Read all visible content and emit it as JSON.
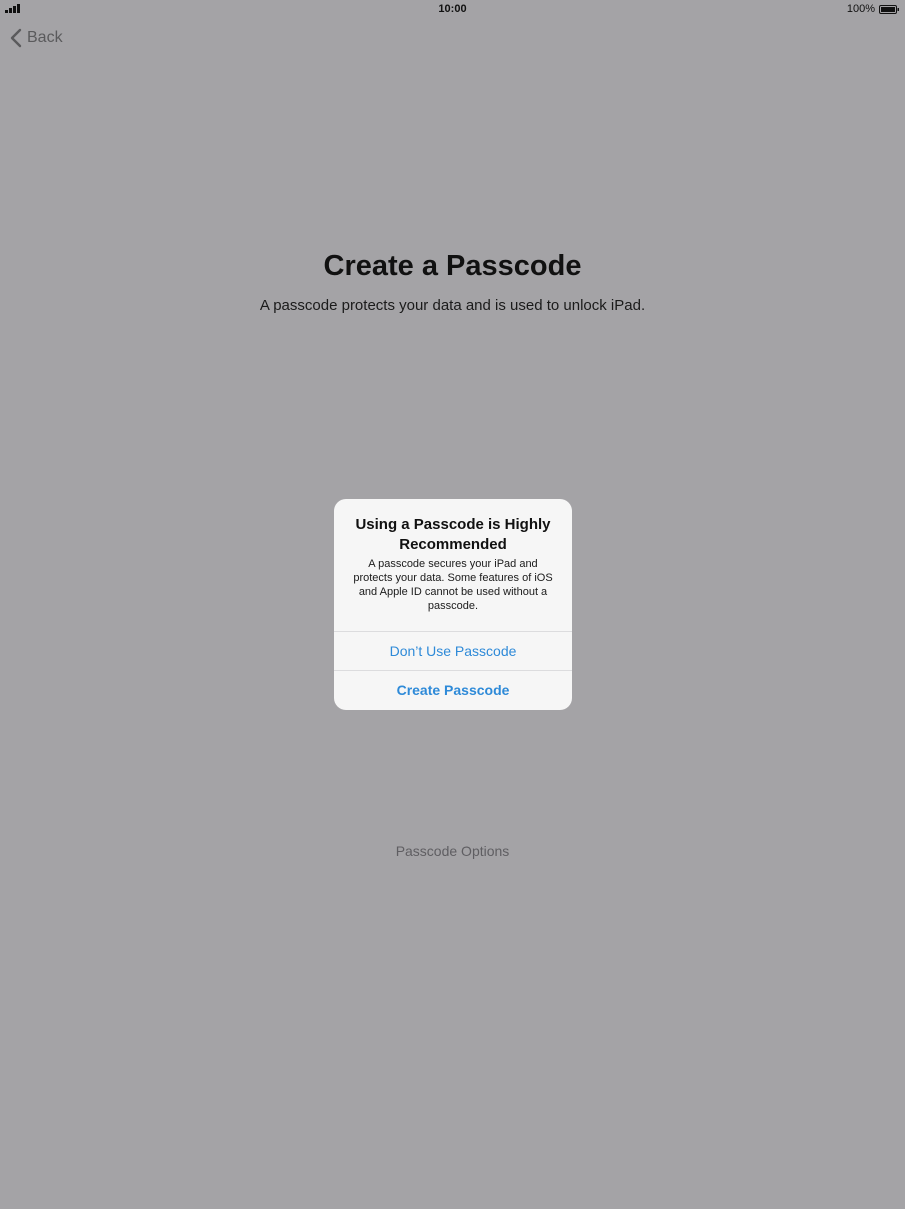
{
  "status_bar": {
    "time": "10:00",
    "battery": "100%",
    "icons": [
      "signal-icon",
      "battery-icon"
    ]
  },
  "nav": {
    "back_label": "Back",
    "back_icon": "chevron-left-icon"
  },
  "page": {
    "title": "Create a Passcode",
    "subtitle": "A passcode protects your data and is used to unlock iPad.",
    "options_label": "Passcode Options"
  },
  "alert": {
    "title": "Using a Passcode is Highly Recommended",
    "message": "A passcode secures your iPad and protects your data. Some features of iOS and Apple ID cannot be used without a passcode.",
    "buttons": {
      "dont_use": "Don’t Use Passcode",
      "create": "Create Passcode"
    }
  },
  "colors": {
    "dimmed_background": "#a4a3a6",
    "alert_background": "#f6f6f6",
    "accent": "#2e8ad8"
  }
}
